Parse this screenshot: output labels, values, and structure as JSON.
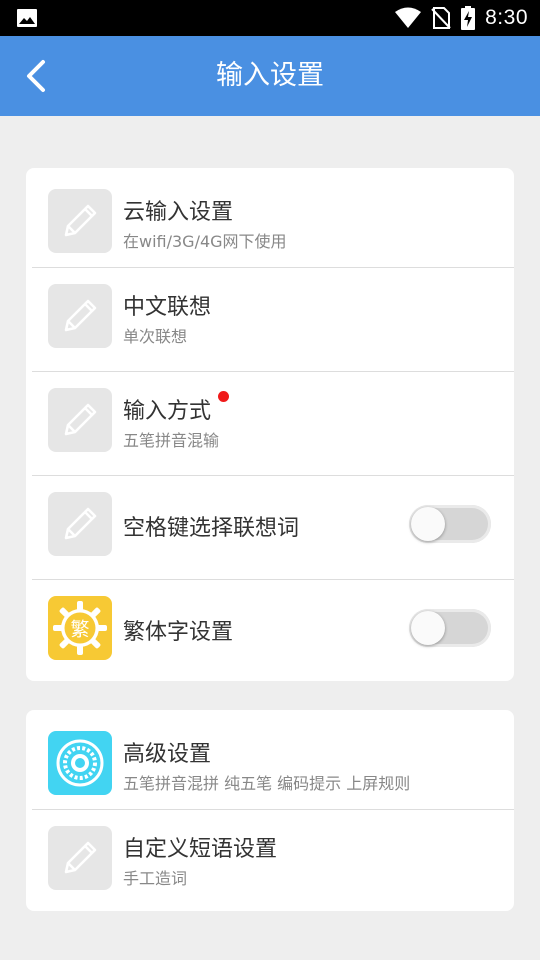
{
  "status_bar": {
    "time": "8:30",
    "icons": [
      "image-icon",
      "wifi-icon",
      "no-sim-icon",
      "battery-charging-icon"
    ]
  },
  "app_bar": {
    "title": "输入设置",
    "back_icon": "back-arrow-icon"
  },
  "colors": {
    "app_bar": "#4a90e2",
    "background": "#eeeeee",
    "badge_dot": "#f01a1a",
    "traditional_icon": "#f7c934",
    "advanced_icon": "#42d4f2"
  },
  "sections": [
    {
      "items": [
        {
          "title": "云输入设置",
          "subtitle": "在wifi/3G/4G网下使用",
          "icon": "pencil-icon"
        },
        {
          "title": "中文联想",
          "subtitle": "单次联想",
          "icon": "pencil-icon"
        },
        {
          "title": "输入方式",
          "subtitle": "五笔拼音混输",
          "icon": "pencil-icon",
          "badge": true
        },
        {
          "title": "空格键选择联想词",
          "icon": "pencil-icon",
          "toggle": "off"
        },
        {
          "title": "繁体字设置",
          "icon": "traditional-char-icon",
          "icon_char": "繁",
          "toggle": "off"
        }
      ]
    },
    {
      "items": [
        {
          "title": "高级设置",
          "subtitle": "五笔拼音混拼 纯五笔 编码提示 上屏规则",
          "icon": "gear-icon"
        },
        {
          "title": "自定义短语设置",
          "subtitle": "手工造词",
          "icon": "pencil-icon"
        }
      ]
    }
  ]
}
